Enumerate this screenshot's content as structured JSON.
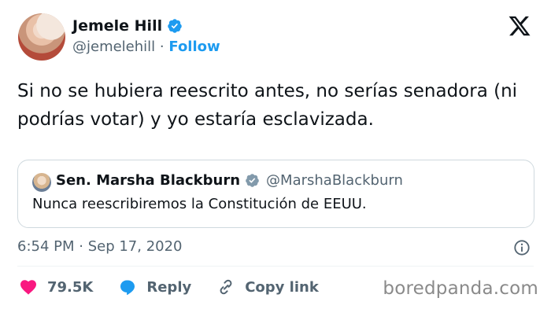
{
  "author": {
    "name": "Jemele Hill",
    "handle": "@jemelehill",
    "separator": "·",
    "follow_label": "Follow"
  },
  "tweet_text": "Si no se hubiera reescrito antes, no serías senadora (ni podrías votar) y yo estaría esclavizada.",
  "quoted": {
    "name": "Sen. Marsha Blackburn",
    "handle": "@MarshaBlackburn",
    "text": "Nunca reescribiremos la Constitución de EEUU."
  },
  "timestamp": "6:54 PM · Sep 17, 2020",
  "actions": {
    "likes": "79.5K",
    "reply_label": "Reply",
    "copy_label": "Copy link"
  },
  "watermark": "boredpanda.com",
  "colors": {
    "accent": "#1d9bf0",
    "like": "#f91880",
    "text": "#0f1419",
    "muted": "#536471"
  },
  "icons": [
    "verified-badge-icon",
    "x-logo-icon",
    "info-icon",
    "heart-icon",
    "reply-bubble-icon",
    "link-icon"
  ]
}
